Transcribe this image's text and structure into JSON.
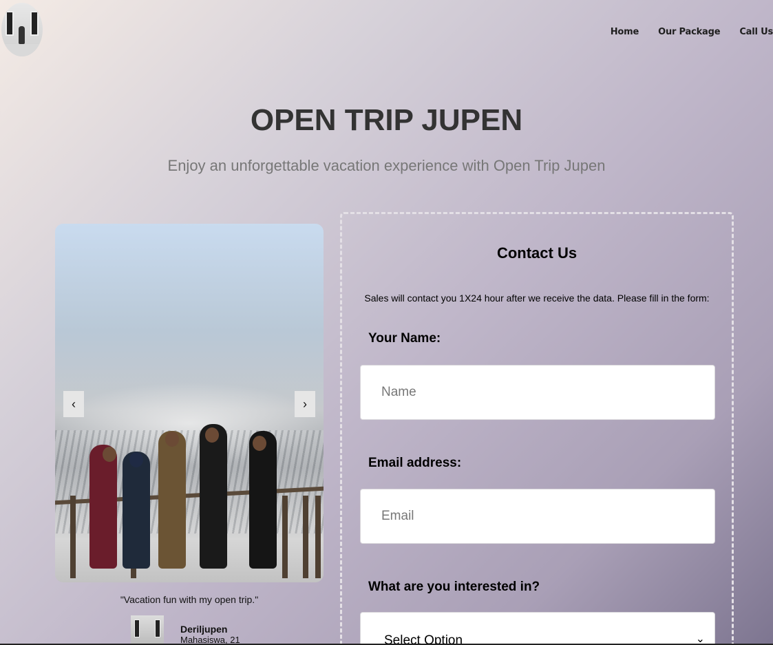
{
  "nav": {
    "items": [
      {
        "label": "Home"
      },
      {
        "label": "Our Package"
      },
      {
        "label": "Call Us"
      }
    ]
  },
  "hero": {
    "title": "OPEN TRIP JUPEN",
    "subtitle": "Enjoy an unforgettable vacation experience with Open Trip Jupen"
  },
  "carousel": {
    "prev_label": "‹",
    "next_label": "›"
  },
  "testimonial": {
    "quote": "\"Vacation fun with my open trip.\"",
    "name": "Deriljupen",
    "role": "Mahasiswa, 21"
  },
  "contact": {
    "title": "Contact Us",
    "intro": "Sales will contact you 1X24 hour after we receive the data. Please fill in the form:",
    "name_label": "Your Name:",
    "name_placeholder": "Name",
    "email_label": "Email address:",
    "email_placeholder": "Email",
    "interest_label": "What are you interested in?",
    "interest_selected": "Select Option"
  }
}
